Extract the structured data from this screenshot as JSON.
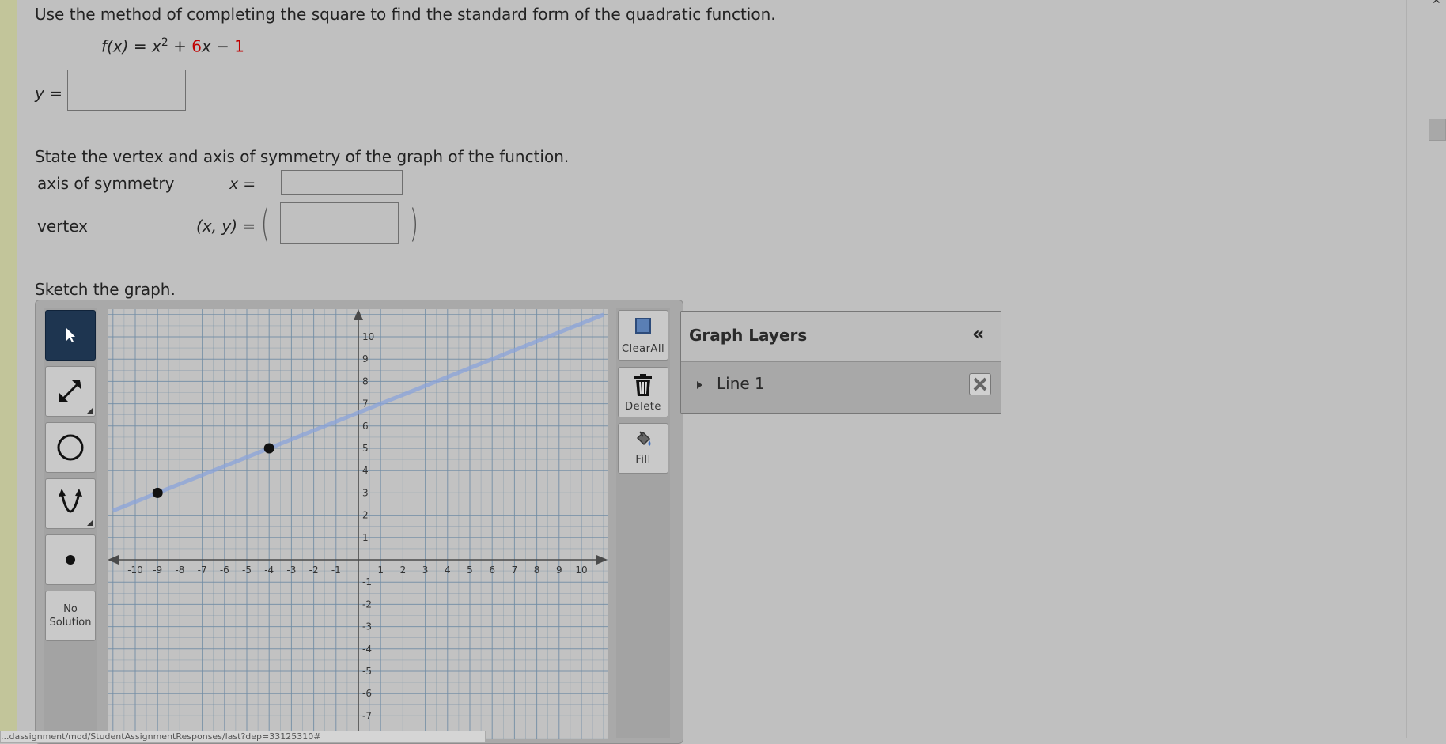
{
  "problem": {
    "instruction": "Use the method of completing the square to find the standard form of the quadratic function.",
    "function_name": "f(x)",
    "equals": " = ",
    "x_var": "x",
    "exponent": "2",
    "plus": " + ",
    "coef": "6",
    "x_term": "x",
    "minus": " − ",
    "constant": "1",
    "y_label": "y =",
    "y_value": ""
  },
  "vertex_section": {
    "instruction": "State the vertex and axis of symmetry of the graph of the function.",
    "axis_label": "axis of symmetry",
    "axis_eq": "x =",
    "axis_value": "",
    "vertex_label": "vertex",
    "vertex_eq": "(x, y) =",
    "open_paren": "(",
    "close_paren": ")",
    "vertex_value": ""
  },
  "sketch": {
    "instruction": "Sketch the graph."
  },
  "tools": {
    "no_solution": "No Solution",
    "clear_all": "ClearAll",
    "delete": "Delete",
    "fill": "Fill"
  },
  "layers": {
    "title": "Graph Layers",
    "collapse": "«",
    "items": [
      {
        "label": "Line 1"
      }
    ]
  },
  "colors": {
    "active_tool": "#1e3550",
    "grid_minor": "#6f8ba3",
    "line": "#8aa3d9",
    "axis": "#4a4a4a"
  },
  "chart_data": {
    "type": "line",
    "xlim": [
      -11,
      11
    ],
    "ylim": [
      -8,
      11
    ],
    "xticks": [
      -10,
      -9,
      -8,
      -7,
      -6,
      -5,
      -4,
      -3,
      -2,
      -1,
      1,
      2,
      3,
      4,
      5,
      6,
      7,
      8,
      9,
      10
    ],
    "yticks": [
      -7,
      -6,
      -5,
      -4,
      -3,
      -2,
      -1,
      1,
      2,
      3,
      4,
      5,
      6,
      7,
      8,
      9,
      10
    ],
    "grid": true,
    "points": [
      {
        "x": -9,
        "y": 3
      },
      {
        "x": -4,
        "y": 5
      }
    ],
    "line": {
      "slope": 0.4,
      "intercept": 6.6
    }
  },
  "status_bar": {
    "text": "...dassignment/mod/StudentAssignmentResponses/last?dep=33125310#"
  }
}
